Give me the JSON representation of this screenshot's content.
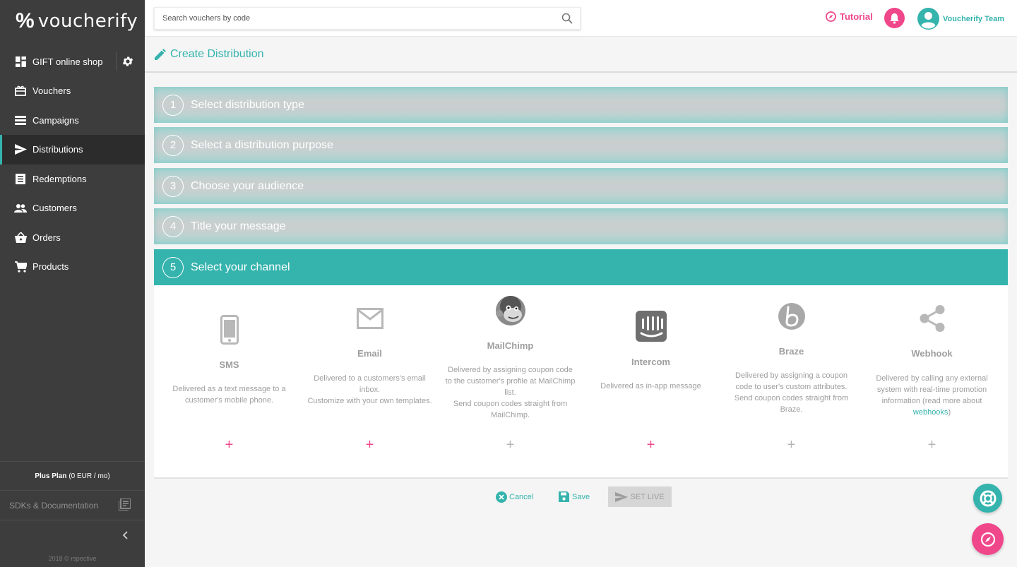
{
  "app": {
    "brand": "voucherify",
    "brand_mark": "%"
  },
  "sidebar": {
    "project": "GIFT online shop",
    "items": [
      {
        "label": "Vouchers",
        "icon": "gift-icon"
      },
      {
        "label": "Campaigns",
        "icon": "list-icon"
      },
      {
        "label": "Distributions",
        "icon": "send-icon",
        "active": true
      },
      {
        "label": "Redemptions",
        "icon": "document-icon"
      },
      {
        "label": "Customers",
        "icon": "people-icon"
      },
      {
        "label": "Orders",
        "icon": "basket-icon"
      },
      {
        "label": "Products",
        "icon": "cart-icon"
      }
    ],
    "plan_name": "Plus Plan",
    "plan_price": "(0 EUR / mo)",
    "sdk_label": "SDKs & Documentation",
    "copyright": "2018 © rspective"
  },
  "topbar": {
    "search_placeholder": "Search vouchers by code",
    "tutorial": "Tutorial",
    "team": "Voucherify Team"
  },
  "page": {
    "title": "Create Distribution"
  },
  "steps": [
    {
      "num": "1",
      "label": "Select distribution type"
    },
    {
      "num": "2",
      "label": "Select a distribution purpose"
    },
    {
      "num": "3",
      "label": "Choose your audience"
    },
    {
      "num": "4",
      "label": "Title your message"
    },
    {
      "num": "5",
      "label": "Select your channel",
      "active": true
    }
  ],
  "channels": [
    {
      "name": "SMS",
      "desc": "Delivered as a text message to a customer's mobile phone.",
      "icon": "phone-icon",
      "enabled": true
    },
    {
      "name": "Email",
      "desc": "Delivered to a customers's email inbox.\nCustomize with your own templates.",
      "icon": "email-icon",
      "enabled": true
    },
    {
      "name": "MailChimp",
      "desc": "Delivered by assigning coupon code to the customer's profile at MailChimp list.\nSend coupon codes straight from MailChimp.",
      "icon": "mailchimp-icon",
      "enabled": false
    },
    {
      "name": "Intercom",
      "desc": "Delivered as in-app message",
      "icon": "intercom-icon",
      "enabled": true
    },
    {
      "name": "Braze",
      "desc": "Delivered by assigning a coupon code to user's custom attributes.\nSend coupon codes straight from Braze.",
      "icon": "braze-icon",
      "enabled": false
    },
    {
      "name": "Webhook",
      "desc_before": "Delivered by calling any external system with real-time promotion information (read more about ",
      "desc_link": "webhooks",
      "desc_after": ")",
      "icon": "share-icon",
      "enabled": false
    }
  ],
  "channel_add_symbol": "+",
  "actions": {
    "cancel": "Cancel",
    "save": "Save",
    "set_live": "SET LIVE"
  },
  "colors": {
    "accent": "#35b3ad",
    "pink": "#f0478b",
    "sidebar": "#3d3d3d"
  }
}
